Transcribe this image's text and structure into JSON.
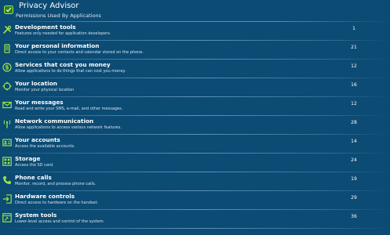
{
  "header": {
    "title": "Privacy Advisor",
    "subtitle": "Permissions Used By Applications",
    "icon": "privacy-advisor-app-icon"
  },
  "colors": {
    "background": "#0b4b74",
    "icon_green": "#9be34a",
    "text": "#ffffff"
  },
  "items": [
    {
      "title": "Development tools",
      "desc": "Features only needed for application developers.",
      "count": "1",
      "icon": "wrench-screwdriver-icon"
    },
    {
      "title": "Your personal information",
      "desc": "Direct access to your contacts and calendar stored on the phone.",
      "count": "21",
      "icon": "phone-device-icon"
    },
    {
      "title": "Services that cost you money",
      "desc": "Allow applications to do things that can cost you money.",
      "count": "12",
      "icon": "dollar-coin-icon"
    },
    {
      "title": "Your location",
      "desc": "Monitor your physical location",
      "count": "16",
      "icon": "location-target-icon"
    },
    {
      "title": "Your messages",
      "desc": "Read and write your SMS, e-mail, and other messages.",
      "count": "12",
      "icon": "envelope-icon"
    },
    {
      "title": "Network communication",
      "desc": "Allow applications to access various network features.",
      "count": "28",
      "icon": "antenna-icon"
    },
    {
      "title": "Your accounts",
      "desc": "Access the available accounts.",
      "count": "14",
      "icon": "account-card-icon"
    },
    {
      "title": "Storage",
      "desc": "Access the SD card.",
      "count": "24",
      "icon": "storage-grid-icon"
    },
    {
      "title": "Phone calls",
      "desc": "Monitor, record, and process phone calls.",
      "count": "19",
      "icon": "phone-handset-icon"
    },
    {
      "title": "Hardware controls",
      "desc": "Direct access to hardware on the handset.",
      "count": "29",
      "icon": "hardware-login-icon"
    },
    {
      "title": "System tools",
      "desc": "Lower-level access and control of the system.",
      "count": "36",
      "icon": "system-tools-icon"
    }
  ]
}
